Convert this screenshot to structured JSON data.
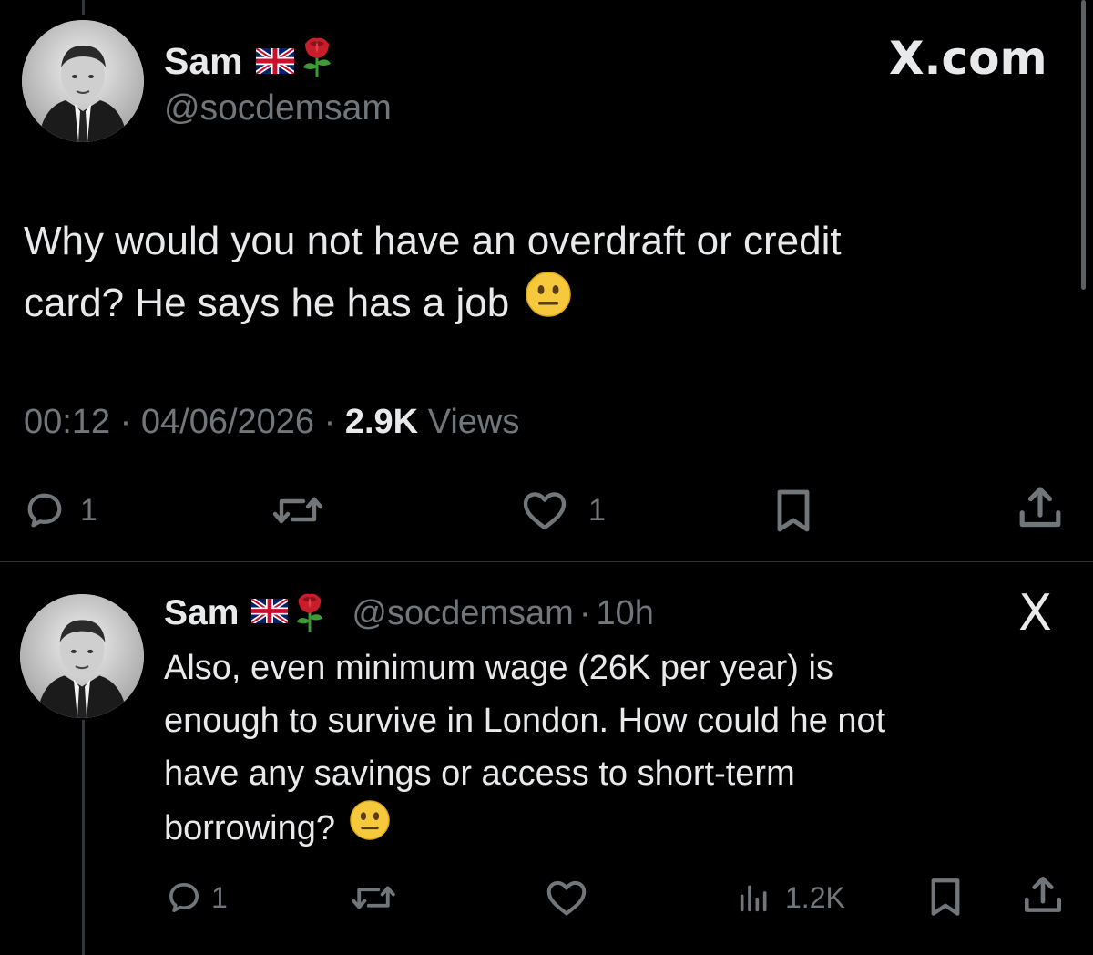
{
  "main_tweet": {
    "author_name": "Sam",
    "author_handle": "@socdemsam",
    "flag_emoji": "uk-flag-icon",
    "rose_emoji": "rose-icon",
    "brand_label": "X.com",
    "text_line1": "Why would you not have an overdraft or credit",
    "text_line2": "card? He says he has a job",
    "time": "00:12",
    "date": "04/06/2026",
    "views_count": "2.9K",
    "views_label": "Views",
    "separator": "·",
    "reply_count": "1",
    "like_count": "1"
  },
  "reply_tweet": {
    "author_name": "Sam",
    "author_handle": "@socdemsam",
    "age": "10h",
    "separator": "·",
    "brand_label": "X",
    "text_lines": [
      "Also, even minimum wage (26K per year) is",
      "enough to survive in London. How could he not",
      "have any savings or access to short-term",
      "borrowing?"
    ],
    "reply_count": "1",
    "views_count": "1.2K"
  },
  "colors": {
    "background": "#000000",
    "text": "#e7e9ea",
    "muted": "#71767b",
    "divider": "#2f3336"
  }
}
